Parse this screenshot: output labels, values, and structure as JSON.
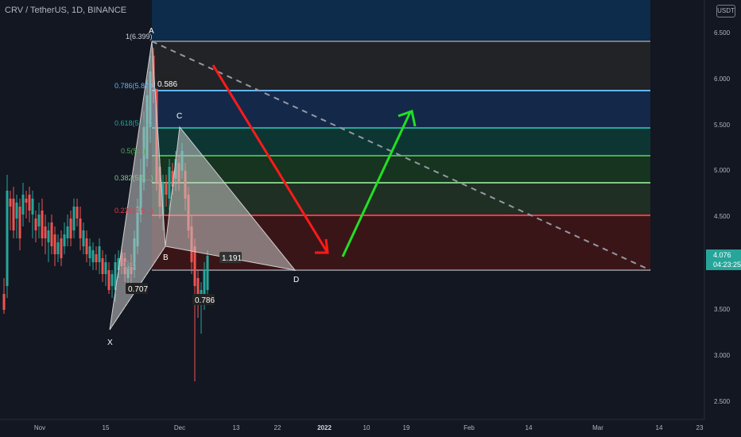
{
  "header": {
    "title": "CRV / TetherUS, 1D, BINANCE"
  },
  "unit_button": "USDT",
  "last_price": {
    "value": "4.076",
    "countdown": "04:23:25",
    "color": "#26a69a"
  },
  "colors": {
    "up": "#26a69a",
    "down": "#ef5350",
    "background": "#131722",
    "pattern": "#c8c8c8"
  },
  "y_axis": {
    "ticks": [
      "6.500",
      "6.000",
      "5.500",
      "5.000",
      "4.500",
      "4.000",
      "3.500",
      "3.000",
      "2.500"
    ]
  },
  "x_axis": {
    "ticks": [
      "Nov",
      "15",
      "Dec",
      "13",
      "22",
      "2022",
      "10",
      "19",
      "Feb",
      "14",
      "Mar",
      "14",
      "23"
    ],
    "bold": "2022"
  },
  "fib_levels": [
    {
      "label": "1(6.399)",
      "color": "#787b86"
    },
    {
      "label": "0.786(5.870)",
      "color": "#64b5f6"
    },
    {
      "label": "0.618(5.4...)",
      "color": "#26a69a"
    },
    {
      "label": "0.5(5...)",
      "color": "#4caf50"
    },
    {
      "label": "0.382(5.0...)",
      "color": "#81c784"
    },
    {
      "label": "0.236(4.5...)",
      "color": "#f23645"
    },
    {
      "label": "0(3.9...)",
      "color": "#787b86"
    }
  ],
  "pattern_points": {
    "X": "X",
    "A": "A",
    "B": "B",
    "C": "C",
    "D": "D"
  },
  "ratios": {
    "xab": "0.586",
    "abc": "0.707",
    "bcd": "1.191",
    "xad": "0.786"
  },
  "arrows": {
    "down_color": "#ff1a1a",
    "up_color": "#22e022"
  }
}
